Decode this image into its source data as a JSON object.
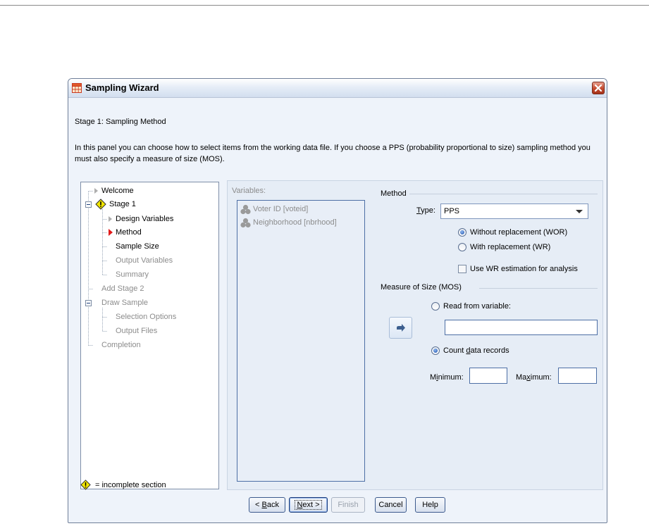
{
  "window": {
    "title": "Sampling Wizard"
  },
  "stage": {
    "title": "Stage 1: Sampling Method",
    "description": "In this panel you can choose how to select items from the working data file. If you choose a PPS (probability proportional to size) sampling method you must also specify a measure of size (MOS)."
  },
  "tree": {
    "welcome": "Welcome",
    "stage1": "Stage 1",
    "design_variables": "Design Variables",
    "method": "Method",
    "sample_size": "Sample Size",
    "output_variables": "Output Variables",
    "summary": "Summary",
    "add_stage2": "Add Stage 2",
    "draw_sample": "Draw Sample",
    "selection_options": "Selection Options",
    "output_files": "Output Files",
    "completion": "Completion"
  },
  "legend": {
    "text": "= incomplete section"
  },
  "variables": {
    "label": "Variables:",
    "items": [
      "Voter ID [voteid]",
      "Neighborhood [nbrhood]"
    ]
  },
  "method": {
    "group_label": "Method",
    "type_label": "Type:",
    "type_value": "PPS",
    "without_replacement": "Without replacement (WOR)",
    "with_replacement": "With replacement (WR)",
    "use_wr_estimation": "Use WR estimation for analysis",
    "without_replacement_selected": true,
    "use_wr_checked": false
  },
  "mos": {
    "group_label": "Measure of Size (MOS)",
    "read_from_variable": "Read from variable:",
    "count_data_records": "Count data records",
    "count_selected": true,
    "minimum_label": "Minimum:",
    "maximum_label": "Maximum:",
    "minimum_value": "",
    "maximum_value": "",
    "variable_value": ""
  },
  "buttons": {
    "back": "< Back",
    "next": "Next >",
    "finish": "Finish",
    "cancel": "Cancel",
    "help": "Help"
  },
  "colors": {
    "window_bg": "#eef3fa",
    "accent": "#1c4fa8",
    "warning": "#f2e600",
    "current_step": "#e21a1a"
  }
}
